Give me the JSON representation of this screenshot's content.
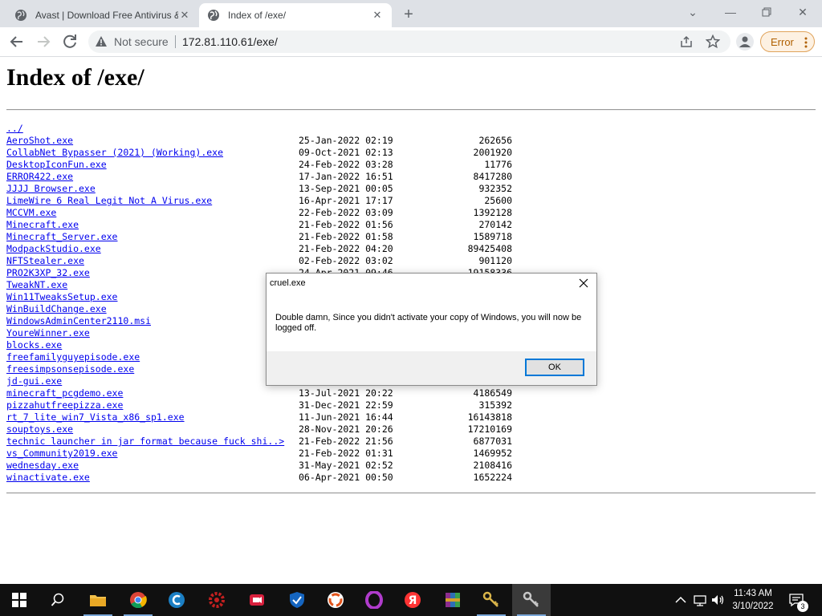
{
  "browser": {
    "tabs": [
      {
        "title": "Avast | Download Free Antivirus & VPN"
      },
      {
        "title": "Index of /exe/"
      }
    ],
    "address": {
      "security_label": "Not secure",
      "url": "172.81.110.61/exe/"
    },
    "error_label": "Error"
  },
  "page": {
    "title": "Index of /exe/",
    "parent_link": "../",
    "files": [
      {
        "name": "AeroShot.exe",
        "date": "25-Jan-2022 02:19",
        "size": "262656"
      },
      {
        "name": "CollabNet Bypasser (2021) (Working).exe",
        "date": "09-Oct-2021 02:13",
        "size": "2001920"
      },
      {
        "name": "DesktopIconFun.exe",
        "date": "24-Feb-2022 03:28",
        "size": "11776"
      },
      {
        "name": "ERROR422.exe",
        "date": "17-Jan-2022 16:51",
        "size": "8417280"
      },
      {
        "name": "JJJJ Browser.exe",
        "date": "13-Sep-2021 00:05",
        "size": "932352"
      },
      {
        "name": "LimeWire 6 Real Legit Not A Virus.exe",
        "date": "16-Apr-2021 17:17",
        "size": "25600"
      },
      {
        "name": "MCCVM.exe",
        "date": "22-Feb-2022 03:09",
        "size": "1392128"
      },
      {
        "name": "Minecraft.exe",
        "date": "21-Feb-2022 01:56",
        "size": "270142"
      },
      {
        "name": "Minecraft_Server.exe",
        "date": "21-Feb-2022 01:58",
        "size": "1589718"
      },
      {
        "name": "ModpackStudio.exe",
        "date": "21-Feb-2022 04:20",
        "size": "89425408"
      },
      {
        "name": "NFTStealer.exe",
        "date": "02-Feb-2022 03:02",
        "size": "901120"
      },
      {
        "name": "PRO2K3XP_32.exe",
        "date": "24-Apr-2021 09:46",
        "size": "19158336"
      },
      {
        "name": "TweakNT.exe",
        "date": "",
        "size": ""
      },
      {
        "name": "Win11TweaksSetup.exe",
        "date": "",
        "size": ""
      },
      {
        "name": "WinBuildChange.exe",
        "date": "",
        "size": ""
      },
      {
        "name": "WindowsAdminCenter2110.msi",
        "date": "",
        "size": ""
      },
      {
        "name": "YoureWinner.exe",
        "date": "",
        "size": ""
      },
      {
        "name": "blocks.exe",
        "date": "",
        "size": ""
      },
      {
        "name": "freefamilyguyepisode.exe",
        "date": "",
        "size": ""
      },
      {
        "name": "freesimpsonsepisode.exe",
        "date": "",
        "size": ""
      },
      {
        "name": "jd-gui.exe",
        "date": "",
        "size": ""
      },
      {
        "name": "minecraft_pcgdemo.exe",
        "date": "13-Jul-2021 20:22",
        "size": "4186549"
      },
      {
        "name": "pizzahutfreepizza.exe",
        "date": "31-Dec-2021 22:59",
        "size": "315392"
      },
      {
        "name": "rt_7_lite_win7_Vista_x86_sp1.exe",
        "date": "11-Jun-2021 16:44",
        "size": "16143818"
      },
      {
        "name": "souptoys.exe",
        "date": "28-Nov-2021 20:26",
        "size": "17210169"
      },
      {
        "name": "technic launcher in jar format because fuck shi..>",
        "date": "21-Feb-2022 21:56",
        "size": "6877031"
      },
      {
        "name": "vs_Community2019.exe",
        "date": "21-Feb-2022 01:31",
        "size": "1469952"
      },
      {
        "name": "wednesday.exe",
        "date": "31-May-2021 02:52",
        "size": "2108416"
      },
      {
        "name": "winactivate.exe",
        "date": "06-Apr-2021 00:50",
        "size": "1652224"
      }
    ]
  },
  "dialog": {
    "title": "cruel.exe",
    "message": "Double damn, Since you didn't activate your copy of Windows, you will now be logged off.",
    "ok_label": "OK"
  },
  "taskbar": {
    "apps": [
      "file-explorer",
      "chrome",
      "ccleaner",
      "red-gear-app",
      "video-recorder",
      "shield-app",
      "swirl-app",
      "opera",
      "yandex",
      "winrar",
      "keys-app",
      "keys-app-active"
    ],
    "clock_time": "11:43 AM",
    "clock_date": "3/10/2022",
    "notification_count": "3"
  },
  "colors": {
    "link": "#0000ee",
    "taskbar": "#101010",
    "tabstrip": "#dee1e6",
    "error_accent": "#b06000"
  }
}
